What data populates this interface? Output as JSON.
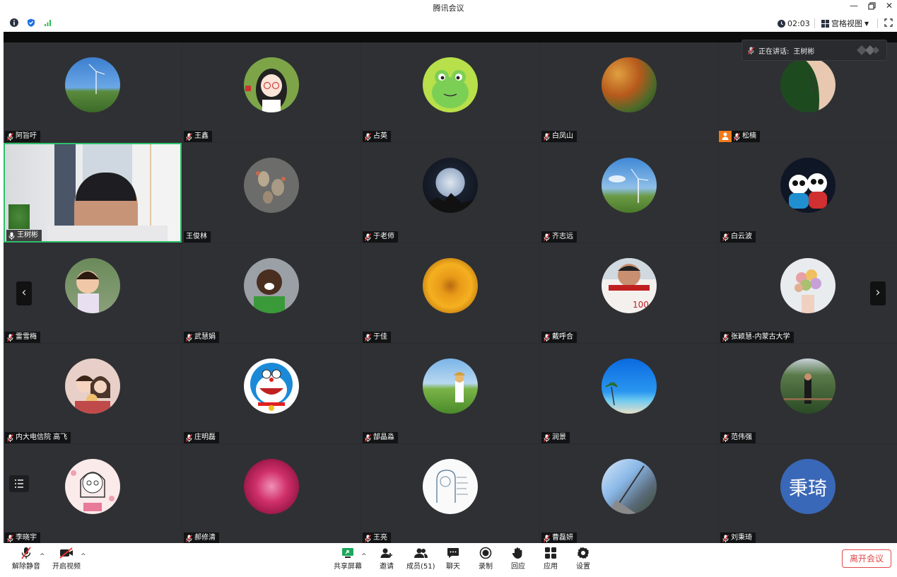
{
  "window": {
    "title": "腾讯会议"
  },
  "topbar": {
    "timer": "02:03",
    "view_label": "宫格视图"
  },
  "speaker": {
    "label": "正在讲话:",
    "name": "王树彬"
  },
  "tiles": [
    {
      "name": "阿旨吁"
    },
    {
      "name": "王鑫"
    },
    {
      "name": "占英"
    },
    {
      "name": "白凤山"
    },
    {
      "name": "松楠"
    },
    {
      "name": "王树彬"
    },
    {
      "name": "王俊林"
    },
    {
      "name": "于老师"
    },
    {
      "name": "齐志远"
    },
    {
      "name": "白云波"
    },
    {
      "name": "雷雪梅"
    },
    {
      "name": "武慧娟"
    },
    {
      "name": "于佳"
    },
    {
      "name": "戴呼合"
    },
    {
      "name": "张颖慧-内蒙古大学"
    },
    {
      "name": "内大电信院  高飞"
    },
    {
      "name": "庄明磊"
    },
    {
      "name": "郜晶淼"
    },
    {
      "name": "润景"
    },
    {
      "name": "范伟强"
    },
    {
      "name": "李晓宇"
    },
    {
      "name": "郝修清"
    },
    {
      "name": "王亮"
    },
    {
      "name": "曹磊妍"
    },
    {
      "name": "刘秉琦",
      "initials": "秉琦"
    }
  ],
  "toolbar": {
    "unmute": "解除静音",
    "start_video": "开启视频",
    "share_screen": "共享屏幕",
    "invite": "邀请",
    "members": "成员(51)",
    "chat": "聊天",
    "record": "录制",
    "reactions": "回应",
    "apps": "应用",
    "settings": "设置",
    "leave": "离开会议"
  },
  "colors": {
    "accent_green": "#2fbf6b",
    "leave_red": "#e04848",
    "tile_bg": "#2f3034",
    "initials_bg": "#3a68b8"
  }
}
